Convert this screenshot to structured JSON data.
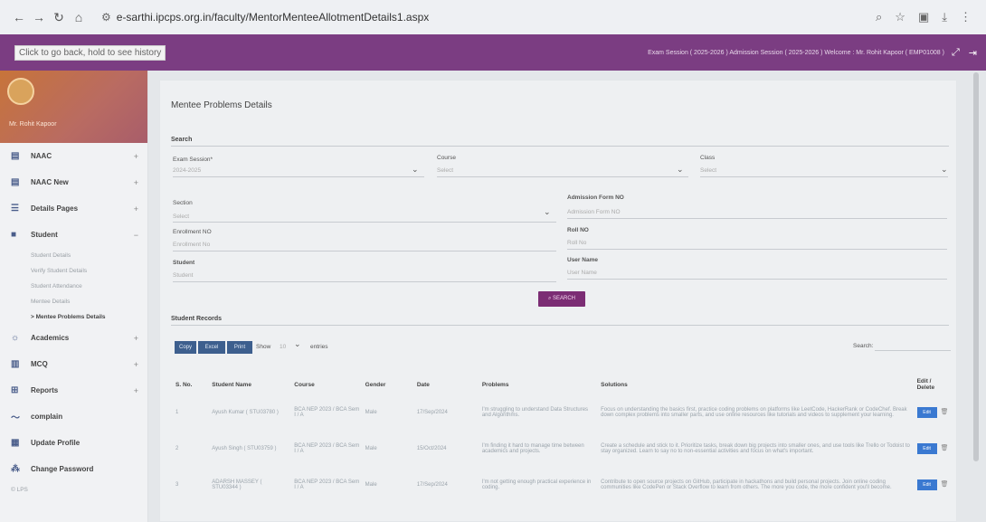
{
  "browser": {
    "url": "e-sarthi.ipcps.org.in/faculty/MentorMenteeAllotmentDetails1.aspx"
  },
  "topbar": {
    "history_tip": "Click to go back, hold to see history",
    "info": "Exam Session ( 2025-2026 )   Admission Session ( 2025-2026 )   Welcome : Mr. Rohit Kapoor ( EMP01008 )"
  },
  "sidebar": {
    "name": "Mr. Rohit Kapoor",
    "items": [
      {
        "label": "NAAC",
        "icon": "document-icon",
        "plus": "+"
      },
      {
        "label": "NAAC New",
        "icon": "document-icon",
        "plus": "+"
      },
      {
        "label": "Details Pages",
        "icon": "list-icon",
        "plus": "+"
      },
      {
        "label": "Student",
        "icon": "user-icon",
        "plus": "−"
      }
    ],
    "subitems": [
      "Student Details",
      "Verify Student Details",
      "Student Attendance",
      "Mentee Details",
      "> Mentee Problems Details"
    ],
    "items2": [
      {
        "label": "Academics",
        "icon": "academic-icon",
        "plus": "+"
      },
      {
        "label": "MCQ",
        "icon": "book-icon",
        "plus": "+"
      },
      {
        "label": "Reports",
        "icon": "report-icon",
        "plus": "+"
      },
      {
        "label": "complain",
        "icon": "complain-icon",
        "plus": ""
      },
      {
        "label": "Update Profile",
        "icon": "profile-icon",
        "plus": ""
      },
      {
        "label": "Change Password",
        "icon": "password-icon",
        "plus": ""
      }
    ],
    "footer": "© LPS"
  },
  "page": {
    "title": "Mentee Problems Details",
    "search_section": "Search",
    "exam_session_label": "Exam Session*",
    "exam_session_value": "2024-2025",
    "course_label": "Course",
    "course_value": "Select",
    "class_label": "Class",
    "class_value": "Select",
    "section_label": "Section",
    "section_value": "Select",
    "admission_label": "Admission Form NO",
    "admission_placeholder": "Admission Form NO",
    "enrollment_label": "Enrollment NO",
    "enrollment_placeholder": "Enrollment No",
    "roll_label": "Roll NO",
    "roll_placeholder": "Roll No",
    "student_label": "Student",
    "student_placeholder": "Student",
    "username_label": "User Name",
    "username_placeholder": "User Name",
    "search_button": "SEARCH",
    "records_section": "Student Records",
    "copy": "Copy",
    "excel": "Excel",
    "print": "Print",
    "show_label": "Show",
    "show_value": "10",
    "entries_label": "entries",
    "search_label": "Search:"
  },
  "table": {
    "headers": [
      "S. No.",
      "Student Name",
      "Course",
      "Gender",
      "Date",
      "Problems",
      "Solutions",
      "Edit / Delete"
    ],
    "rows": [
      [
        "1",
        "Ayush Kumar ( STU03780 )",
        "BCA NEP 2023 / BCA Sem I / A",
        "Male",
        "17/Sep/2024",
        "I'm struggling to understand Data Structures and Algorithms.",
        "Focus on understanding the basics first, practice coding problems on platforms like LeetCode, HackerRank or CodeChef. Break down complex problems into smaller parts, and use online resources like tutorials and videos to supplement your learning.",
        "Edit"
      ],
      [
        "2",
        "Ayush Singh ( STU03759 )",
        "BCA NEP 2023 / BCA Sem I / A",
        "Male",
        "15/Oct/2024",
        "I'm finding it hard to manage time between academics and projects.",
        "Create a schedule and stick to it. Prioritize tasks, break down big projects into smaller ones, and use tools like Trello or Todoist to stay organized. Learn to say no to non-essential activities and focus on what's important.",
        "Edit"
      ],
      [
        "3",
        "ADARSH MASSEY ( STU03344 )",
        "BCA NEP 2023 / BCA Sem I / A",
        "Male",
        "17/Sep/2024",
        "I'm not getting enough practical experience in coding.",
        "Contribute to open source projects on GitHub, participate in hackathons and build personal projects. Join online coding communities like CodePen or Stack Overflow to learn from others. The more you code, the more confident you'll become.",
        "Edit"
      ]
    ]
  }
}
